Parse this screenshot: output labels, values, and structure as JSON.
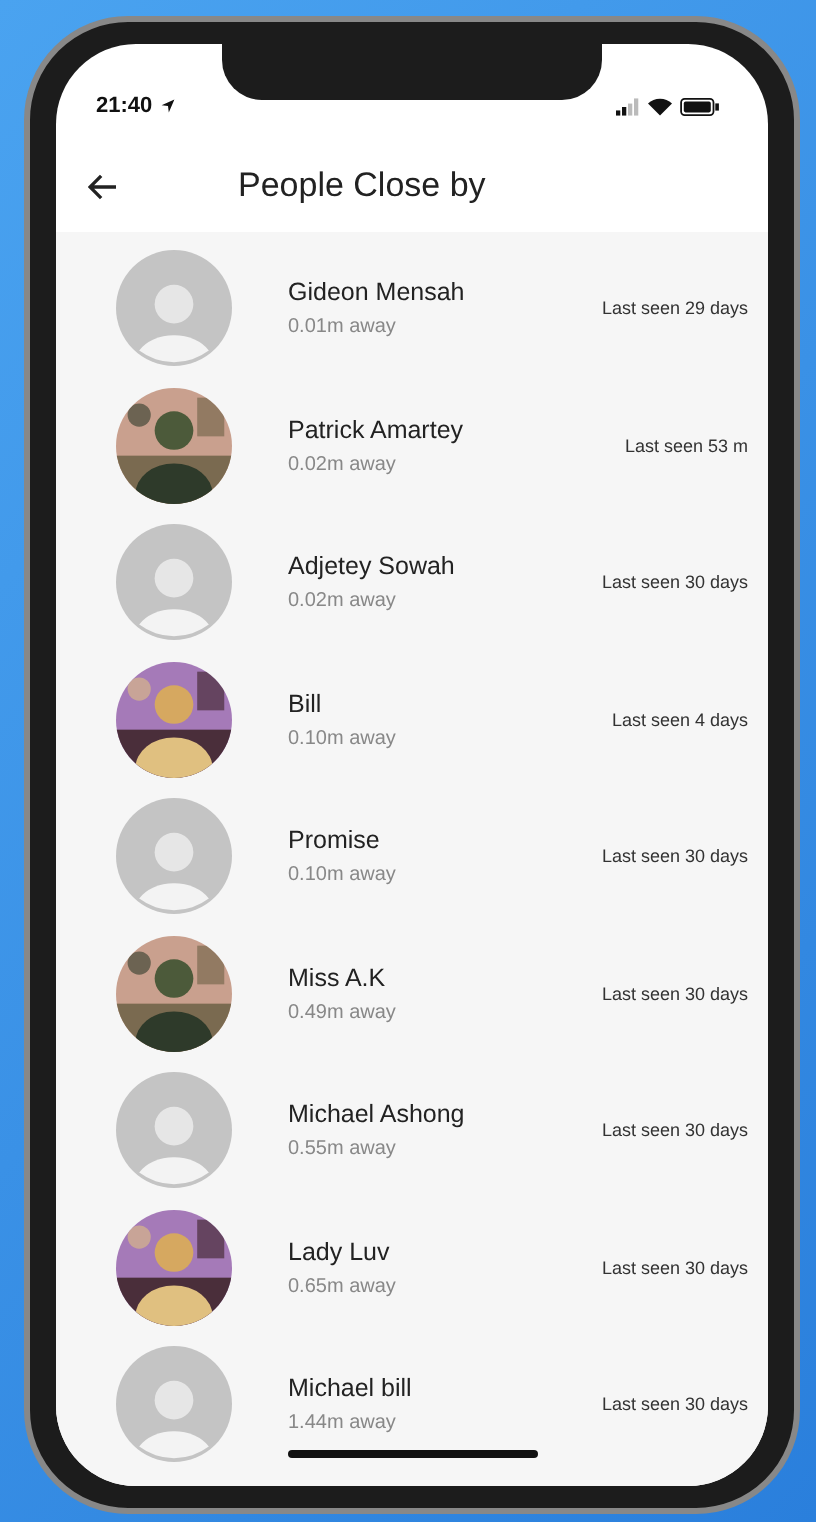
{
  "status_bar": {
    "time": "21:40"
  },
  "header": {
    "title": "People Close by"
  },
  "people": [
    {
      "name": "Gideon Mensah",
      "distance": "0.01m away",
      "last_seen": "Last seen 29 days",
      "avatar": {
        "kind": "placeholder"
      }
    },
    {
      "name": "Patrick Amartey",
      "distance": "0.02m away",
      "last_seen": "Last seen 53 m"
    },
    {
      "name": "Adjetey Sowah",
      "distance": "0.02m away",
      "last_seen": "Last seen 30 days",
      "avatar": {
        "kind": "placeholder"
      }
    },
    {
      "name": "Bill",
      "distance": "0.10m away",
      "last_seen": "Last seen 4 days"
    },
    {
      "name": "Promise",
      "distance": "0.10m away",
      "last_seen": "Last seen 30 days",
      "avatar": {
        "kind": "placeholder"
      }
    },
    {
      "name": "Miss A.K",
      "distance": "0.49m away",
      "last_seen": "Last seen 30 days"
    },
    {
      "name": "Michael Ashong",
      "distance": "0.55m away",
      "last_seen": "Last seen 30 days",
      "avatar": {
        "kind": "placeholder"
      }
    },
    {
      "name": "Lady Luv",
      "distance": "0.65m away",
      "last_seen": "Last seen 30 days"
    },
    {
      "name": "Michael bill",
      "distance": "1.44m away",
      "last_seen": "Last seen 30 days",
      "avatar": {
        "kind": "placeholder"
      }
    }
  ]
}
